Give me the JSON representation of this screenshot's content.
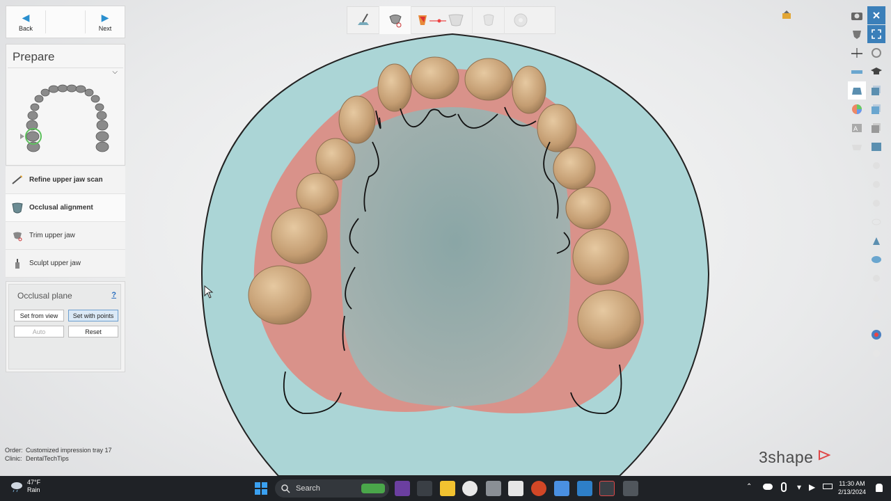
{
  "nav": {
    "back_label": "Back",
    "next_label": "Next"
  },
  "prepare": {
    "title": "Prepare"
  },
  "steps": [
    {
      "label": "Refine upper jaw scan",
      "icon": "refine-scan-icon"
    },
    {
      "label": "Occlusal alignment",
      "icon": "occlusal-alignment-icon"
    },
    {
      "label": "Trim upper jaw",
      "icon": "trim-icon"
    },
    {
      "label": "Sculpt upper jaw",
      "icon": "sculpt-icon"
    }
  ],
  "occlusal_plane": {
    "title": "Occlusal plane",
    "help": "?",
    "set_from_view": "Set from view",
    "set_with_points": "Set with points",
    "auto": "Auto",
    "reset": "Reset"
  },
  "order": {
    "order_label": "Order:",
    "order_value": "Customized impression tray 17",
    "clinic_label": "Clinic:",
    "clinic_value": "DentalTechTips"
  },
  "brand": "3shape",
  "taskbar": {
    "temp": "47°F",
    "weather": "Rain",
    "search_placeholder": "Search",
    "time": "11:30 AM",
    "date": "2/13/2024"
  },
  "colors": {
    "accent": "#2a8fcf",
    "plate": "#a9d4d6",
    "gum": "#d98f86",
    "tooth": "#c8a27a",
    "taskbar": "#1f2226"
  }
}
